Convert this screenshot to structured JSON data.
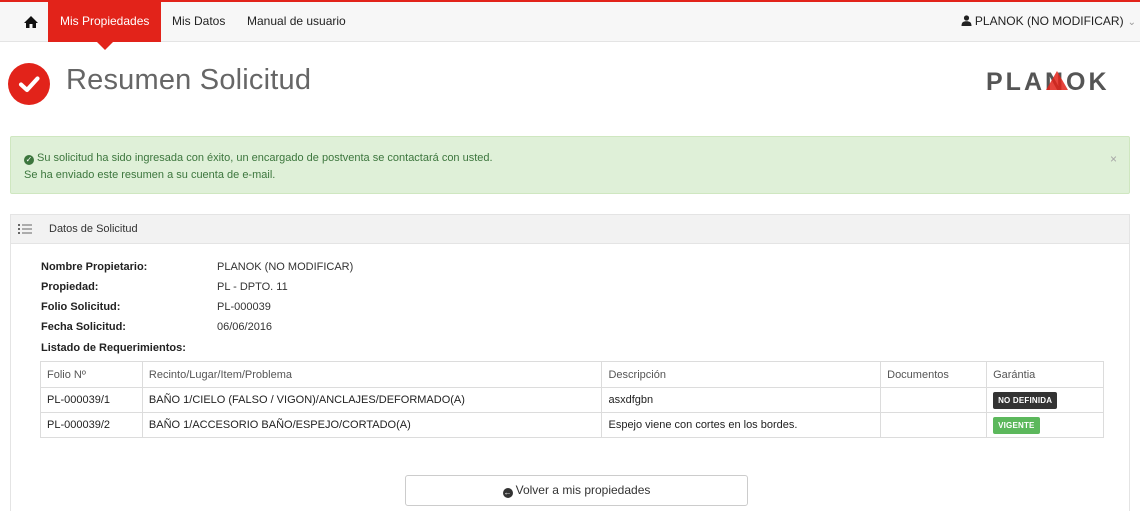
{
  "nav": {
    "items": [
      {
        "label": "Mis Propiedades",
        "active": true
      },
      {
        "label": "Mis Datos",
        "active": false
      },
      {
        "label": "Manual de usuario",
        "active": false
      }
    ],
    "user": "PLANOK (NO MODIFICAR)"
  },
  "page": {
    "title": "Resumen Solicitud",
    "logo_text": "PLANOK"
  },
  "alert": {
    "line1": "Su solicitud ha sido ingresada con éxito, un encargado de postventa se contactará con usted.",
    "line2": "Se ha enviado este resumen a su cuenta de e-mail.",
    "close": "×"
  },
  "panel": {
    "title": "Datos de Solicitud",
    "fields": [
      {
        "label": "Nombre Propietario:",
        "value": "PLANOK (NO MODIFICAR)"
      },
      {
        "label": "Propiedad:",
        "value": "PL - DPTO. 11"
      },
      {
        "label": "Folio Solicitud:",
        "value": "PL-000039"
      },
      {
        "label": "Fecha Solicitud:",
        "value": "06/06/2016"
      }
    ],
    "list_label": "Listado de Requerimientos:"
  },
  "table": {
    "headers": [
      "Folio Nº",
      "Recinto/Lugar/Item/Problema",
      "Descripción",
      "Documentos",
      "Garántia"
    ],
    "rows": [
      {
        "folio": "PL-000039/1",
        "recinto": "BAÑO 1/CIELO (FALSO / VIGON)/ANCLAJES/DEFORMADO(A)",
        "descripcion": "asxdfgbn",
        "documentos": "",
        "garantia": "NO DEFINIDA"
      },
      {
        "folio": "PL-000039/2",
        "recinto": "BAÑO 1/ACCESORIO BAÑO/ESPEJO/CORTADO(A)",
        "descripcion": "Espejo viene con cortes en los bordes.",
        "documentos": "",
        "garantia": "VIGENTE"
      }
    ]
  },
  "back_button": "Volver a mis propiedades",
  "colors": {
    "brand_red": "#e2231a",
    "success_bg": "#dff0d8",
    "badge_green": "#5cb85c",
    "badge_dark": "#333333"
  }
}
